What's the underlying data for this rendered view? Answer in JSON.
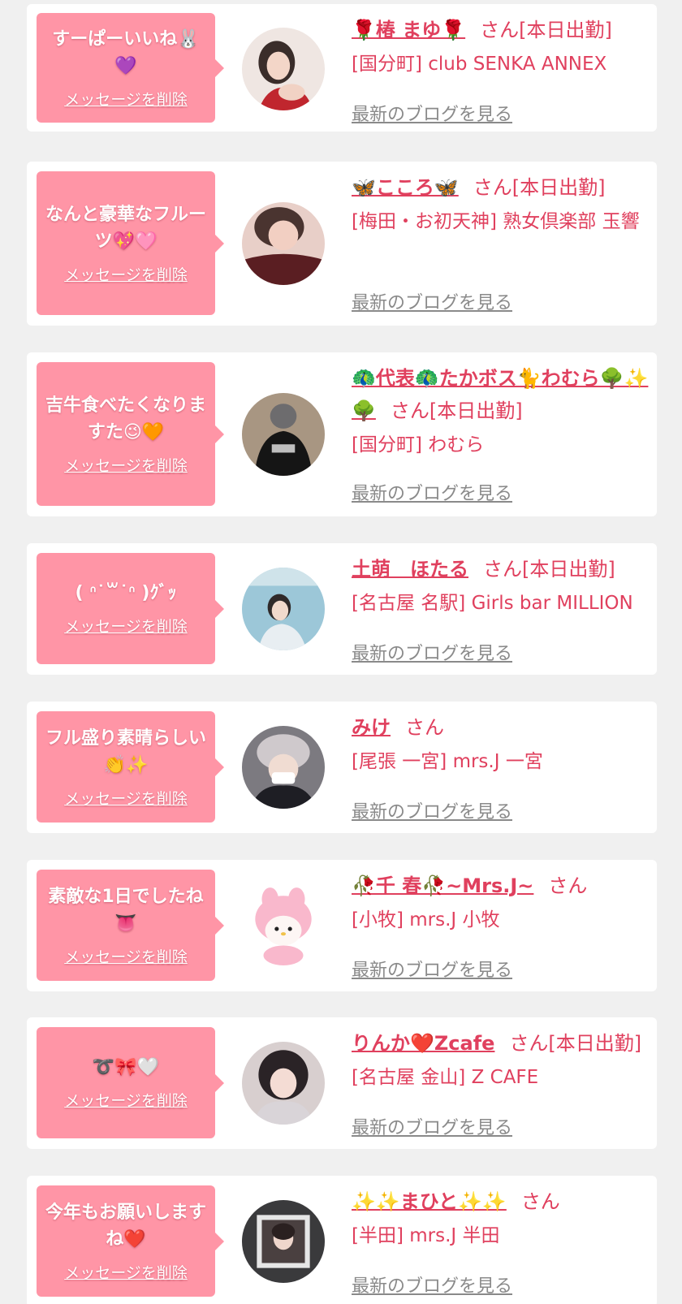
{
  "items": [
    {
      "message": "すーぱーいいね🐰💜",
      "delete_label": "メッセージを削除",
      "name": "🌹椿 まゆ🌹",
      "suffix": "さん[本日出勤]",
      "shop": "[国分町] club SENKA ANNEX",
      "blog_label": "最新のブログを見る",
      "avatar_icon": "avatar-photo"
    },
    {
      "message": "なんと豪華なフルーツ💖🩷",
      "delete_label": "メッセージを削除",
      "name": "🦋こころ🦋",
      "suffix": "さん[本日出勤]",
      "shop": "[梅田・お初天神] 熟女倶楽部 玉響",
      "blog_label": "最新のブログを見る",
      "avatar_icon": "avatar-photo"
    },
    {
      "message": "吉牛食べたくなりますた😉🧡",
      "delete_label": "メッセージを削除",
      "name": "🦚代表🦚たかボス🐈わむら🌳✨🌳",
      "suffix": "さん[本日出勤]",
      "shop": "[国分町] わむら",
      "blog_label": "最新のブログを見る",
      "avatar_icon": "avatar-photo"
    },
    {
      "message": "( ᐢ˙꒳˙ᐢ )ｸﾞｯ",
      "delete_label": "メッセージを削除",
      "name": "土萌　ほたる",
      "suffix": "さん[本日出勤]",
      "shop": "[名古屋 名駅] Girls bar MILLION",
      "blog_label": "最新のブログを見る",
      "avatar_icon": "avatar-photo"
    },
    {
      "message": "フル盛り素晴らしい👏✨",
      "delete_label": "メッセージを削除",
      "name": "みけ",
      "suffix": "さん",
      "shop": "[尾張 一宮] mrs.J 一宮",
      "blog_label": "最新のブログを見る",
      "avatar_icon": "avatar-photo"
    },
    {
      "message": "素敵な1日でしたね👅",
      "delete_label": "メッセージを削除",
      "name": "🥀千 春🥀~Mrs.J~",
      "suffix": "さん",
      "shop": "[小牧] mrs.J 小牧",
      "blog_label": "最新のブログを見る",
      "avatar_icon": "avatar-plush"
    },
    {
      "message": "➰🎀🤍",
      "delete_label": "メッセージを削除",
      "name": "りんか❤️Zcafe",
      "suffix": "さん[本日出勤]",
      "shop": "[名古屋 金山] Z CAFE",
      "blog_label": "最新のブログを見る",
      "avatar_icon": "avatar-photo"
    },
    {
      "message": "今年もお願いしますね❤️",
      "delete_label": "メッセージを削除",
      "name": "✨✨まひと✨✨",
      "suffix": "さん",
      "shop": "[半田] mrs.J 半田",
      "blog_label": "最新のブログを見る",
      "avatar_icon": "avatar-photo"
    }
  ],
  "colors": {
    "page_bg": "#f0f0f0",
    "bubble": "#ff95a6",
    "accent": "#e0405e",
    "link_gray": "#8a8a8a"
  }
}
